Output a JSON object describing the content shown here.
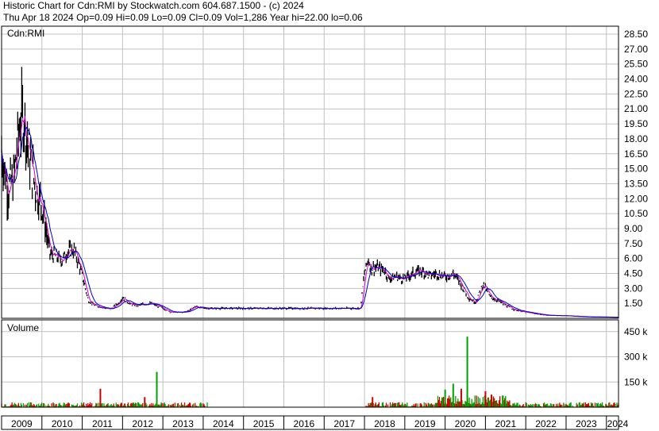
{
  "header": {
    "line1": "Historic Chart for Cdn:RMI by Stockwatch.com 604.687.1500 - (c) 2024",
    "line2": "Thu Apr 18 2024  Op=0.09  Hi=0.09  Lo=0.09  Cl=0.09  Vol=1,286  Year hi=22.00  lo=0.06"
  },
  "chart_data": {
    "type": "line",
    "title": "Cdn:RMI",
    "volume_label": "Volume",
    "price_ticks": [
      "28.50",
      "27.00",
      "25.50",
      "24.00",
      "22.50",
      "21.00",
      "19.50",
      "18.00",
      "16.50",
      "15.00",
      "13.50",
      "12.00",
      "10.50",
      "9.00",
      "7.50",
      "6.00",
      "4.50",
      "3.00",
      "1.50"
    ],
    "volume_ticks": [
      "450 k",
      "300 k",
      "150 k"
    ],
    "year_labels": [
      "2009",
      "2010",
      "2011",
      "2012",
      "2013",
      "2014",
      "2015",
      "2016",
      "2017",
      "2018",
      "2019",
      "2020",
      "2021",
      "2022",
      "2023",
      "2024"
    ],
    "price_range": [
      0,
      29.3
    ],
    "volume_range": [
      0,
      520000
    ],
    "x_range": [
      2009.0,
      2024.3
    ],
    "grid": true,
    "colors": {
      "price": "#000000",
      "ma_short": "#d000d0",
      "ma_long": "#0000c8",
      "volume_up": "#00a000",
      "volume_down": "#d00000",
      "grid": "#c0c0c0"
    },
    "series": [
      {
        "values_x": [
          2009.0,
          2009.15,
          2009.3,
          2009.45,
          2009.55,
          2009.7,
          2009.85,
          2010.0,
          2010.1,
          2010.2,
          2010.35,
          2010.5,
          2010.65,
          2010.8,
          2010.95,
          2011.05,
          2011.15,
          2011.3,
          2011.5,
          2011.7,
          2011.9,
          2012.0,
          2012.2,
          2012.4,
          2012.5,
          2012.7,
          2012.9,
          2013.0,
          2013.2,
          2013.5,
          2013.65,
          2013.8,
          2014.0,
          2014.2,
          2014.5,
          2015.0,
          2016.0,
          2017.0,
          2017.9,
          2018.0,
          2018.1,
          2018.15,
          2018.3,
          2018.5,
          2018.6,
          2018.8,
          2018.9,
          2019.0,
          2019.2,
          2019.4,
          2019.6,
          2019.8,
          2020.0,
          2020.2,
          2020.3,
          2020.45,
          2020.6,
          2020.75,
          2020.85,
          2020.95,
          2021.1,
          2021.3,
          2021.5,
          2021.7,
          2022.0,
          2022.5,
          2023.0,
          2023.5,
          2024.0,
          2024.3
        ],
        "values_y": [
          17.0,
          13.0,
          14.0,
          19.5,
          20.5,
          16.0,
          13.0,
          11.5,
          9.0,
          6.5,
          6.2,
          5.8,
          6.8,
          6.8,
          5.0,
          3.5,
          1.8,
          1.3,
          1.1,
          0.9,
          1.5,
          2.1,
          1.4,
          1.3,
          1.4,
          1.5,
          1.2,
          1.0,
          0.6,
          0.6,
          0.8,
          1.2,
          1.0,
          1.0,
          1.0,
          1.0,
          1.0,
          1.0,
          1.0,
          4.5,
          6.0,
          5.0,
          5.1,
          4.8,
          4.0,
          4.2,
          4.0,
          4.0,
          4.5,
          4.8,
          4.3,
          4.5,
          4.2,
          4.5,
          4.0,
          3.0,
          2.0,
          1.6,
          2.5,
          3.5,
          2.2,
          1.8,
          1.3,
          0.9,
          0.6,
          0.3,
          0.25,
          0.15,
          0.12,
          0.09
        ]
      }
    ]
  }
}
